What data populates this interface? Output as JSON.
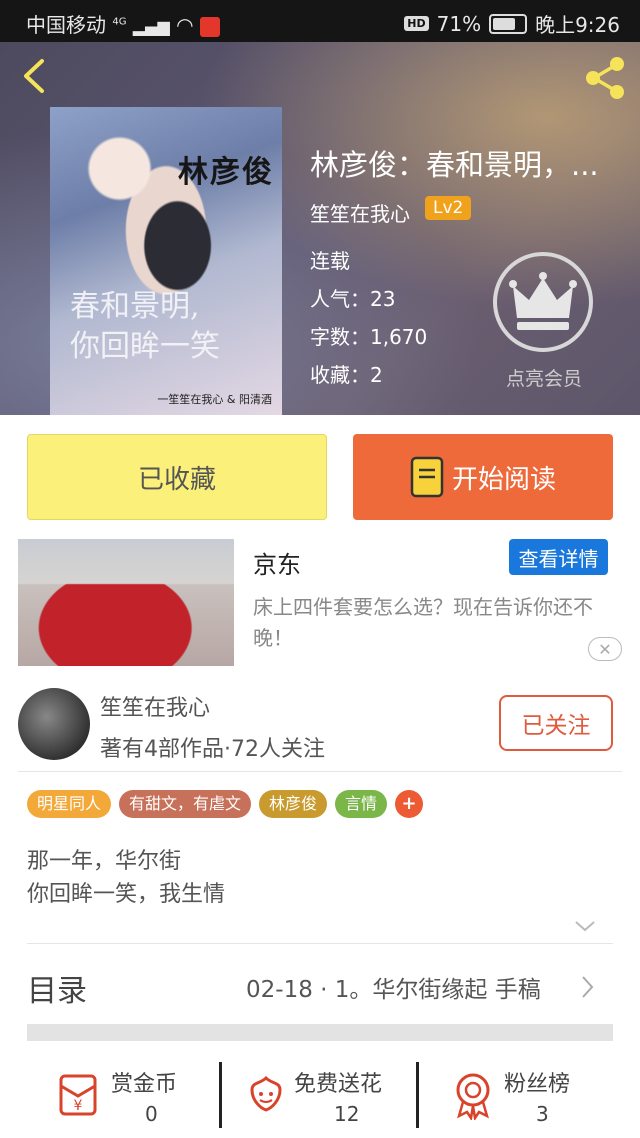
{
  "status_bar": {
    "carrier": "中国移动",
    "network": "4G",
    "hd": "HD",
    "battery": "71%",
    "time": "晚上9:26"
  },
  "book": {
    "cover_title": "林彦俊",
    "cover_subtitle_line1": "春和景明,",
    "cover_subtitle_line2": "你回眸一笑",
    "cover_credit": "一笙笙在我心 & 阳清酒",
    "title": "林彦俊：春和景明，...",
    "author": "笙笙在我心",
    "level": "Lv2",
    "status": "连载",
    "popularity": "人气：23",
    "word_count": "字数：1,670",
    "favorites": "收藏：2",
    "vip_label": "点亮会员"
  },
  "actions": {
    "favorited_label": "已收藏",
    "read_label": "开始阅读"
  },
  "ad": {
    "title": "京东",
    "detail_button": "查看详情",
    "description": "床上四件套要怎么选？现在告诉你还不晚！",
    "close": "✕"
  },
  "author_card": {
    "name": "笙笙在我心",
    "stats": "著有4部作品·72人关注",
    "follow_label": "已关注"
  },
  "tags": [
    {
      "label": "明星同人",
      "color": "#f3a93a"
    },
    {
      "label": "有甜文，有虐文",
      "color": "#c8715a"
    },
    {
      "label": "林彦俊",
      "color": "#c99a2e"
    },
    {
      "label": "言情",
      "color": "#7ab648"
    },
    {
      "label": "+",
      "color": "#ec5b33"
    }
  ],
  "description": {
    "line1": "那一年，华尔街",
    "line2": "你回眸一笑，我生情"
  },
  "toc": {
    "label": "目录",
    "latest": "02-18 · 1。华尔街缘起  手稿"
  },
  "bottom": {
    "reward_label": "赏金币",
    "reward_count": "0",
    "flower_label": "免费送花",
    "flower_count": "12",
    "fans_label": "粉丝榜",
    "fans_count": "3"
  },
  "colors": {
    "accent": "#ee6a3a",
    "favorited_bg": "#fbf07a",
    "detail_button": "#1a78dc",
    "icon_red": "#d8432a"
  }
}
